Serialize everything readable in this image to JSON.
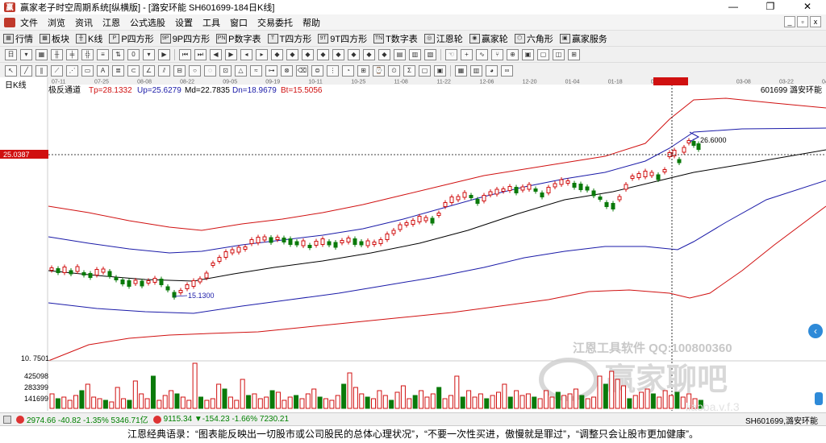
{
  "window": {
    "title": "赢家老子时空周期系统[纵横版] - [潞安环能  SH601699-184日K线]",
    "minimize": "—",
    "maximize": "❐",
    "close": "✕"
  },
  "menu": [
    "文件",
    "浏览",
    "资讯",
    "江恩",
    "公式选股",
    "设置",
    "工具",
    "窗口",
    "交易委托",
    "帮助"
  ],
  "toolbar1": [
    "行情",
    "板块",
    "K线",
    "P四方形",
    "9P四方形",
    "P数字表",
    "T四方形",
    "9T四方形",
    "T数字表",
    "江恩轮",
    "赢家轮",
    "六角形",
    "赢家服务"
  ],
  "chart": {
    "period_label": "日K线",
    "date_ticks": [
      "07-11",
      "07-25",
      "08-08",
      "08-22",
      "09-05",
      "09-19",
      "10-11",
      "10-25",
      "11-08",
      "11-22",
      "12-06",
      "12-20",
      "01-04",
      "01-18",
      "02-01",
      "2024-02-20",
      "03-08",
      "03-22",
      "04-05"
    ],
    "indicator_name": "极反通道",
    "tp": "Tp=28.1332",
    "up": "Up=25.6279",
    "md": "Md=22.7835",
    "dn": "Dn=18.9679",
    "bt": "Bt=15.5056",
    "stock_label": "601699   潞安环能",
    "crosshair_price": "25.0387",
    "high_label": "26.6000",
    "low_label": "15.1300",
    "axis_min_label": "10. 7501",
    "vol_ticks": [
      "425098",
      "283399",
      "141699"
    ],
    "watermark1": "江恩工具软件   QQ:100800360",
    "watermark2": "赢家聊吧",
    "watermark3": "liaoba.v.f.3",
    "colors": {
      "outer_band": "#d01010",
      "inner_band": "#1a1aa8",
      "mid_line": "#000000",
      "up_candle": "#d01010",
      "down_candle": "#0a7a0a",
      "crosshair": "#000000"
    }
  },
  "status": {
    "sh_index": "2974.66 -40.82 -1.35% 5346.71亿",
    "sz_index": "9115.34 ▼-154.23 -1.66% 7230.21",
    "stock": "SH601699,潞安环能"
  },
  "quote": "江恩经典语录：“图表能反映出一切股市或公司股民的总体心理状况”，“不要一次性买进，傲慢就是罪过”，“调整只会让股市更加健康”。"
}
